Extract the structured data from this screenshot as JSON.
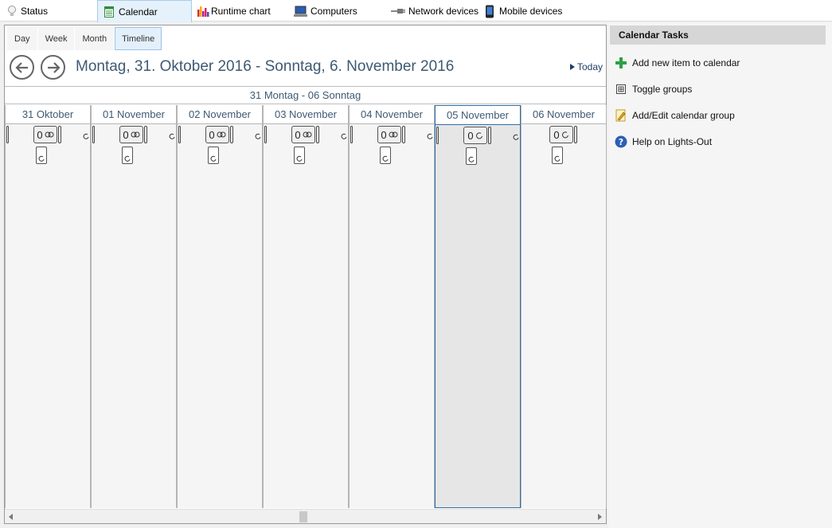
{
  "toptabs": [
    {
      "label": "Status",
      "icon": "lightbulb-icon",
      "active": false
    },
    {
      "label": "Calendar",
      "icon": "calendar-icon",
      "active": true
    },
    {
      "label": "Runtime chart",
      "icon": "bar-chart-icon",
      "active": false
    },
    {
      "label": "Computers",
      "icon": "computer-icon",
      "active": false
    },
    {
      "label": "Network devices",
      "icon": "network-plug-icon",
      "active": false
    },
    {
      "label": "Mobile devices",
      "icon": "mobile-phone-icon",
      "active": false
    }
  ],
  "viewtabs": [
    {
      "label": "Day",
      "active": false
    },
    {
      "label": "Week",
      "active": false
    },
    {
      "label": "Month",
      "active": false
    },
    {
      "label": "Timeline",
      "active": true
    }
  ],
  "calendar": {
    "date_range": "Montag, 31. Oktober 2016 - Sonntag, 6. November 2016",
    "today_label": "Today",
    "week_header": "31 Montag - 06 Sonntag",
    "days": [
      {
        "label": "31 Oktober",
        "count": "0",
        "selected": false
      },
      {
        "label": "01 November",
        "count": "0",
        "selected": false
      },
      {
        "label": "02 November",
        "count": "0",
        "selected": false
      },
      {
        "label": "03 November",
        "count": "0",
        "selected": false
      },
      {
        "label": "04 November",
        "count": "0",
        "selected": false
      },
      {
        "label": "05 November",
        "count": "0",
        "selected": true
      },
      {
        "label": "06 November",
        "count": "0",
        "selected": false
      }
    ]
  },
  "tasks": {
    "title": "Calendar Tasks",
    "items": [
      {
        "label": "Add new item to calendar",
        "icon": "green-plus-icon"
      },
      {
        "label": "Toggle groups",
        "icon": "toggle-groups-icon"
      },
      {
        "label": "Add/Edit calendar group",
        "icon": "edit-pencil-icon"
      },
      {
        "label": "Help on Lights-Out",
        "icon": "help-icon"
      }
    ]
  },
  "colors": {
    "accent": "#3d5a73",
    "selected_border": "#2f6ea8",
    "active_tab": "#e5f1fb"
  }
}
